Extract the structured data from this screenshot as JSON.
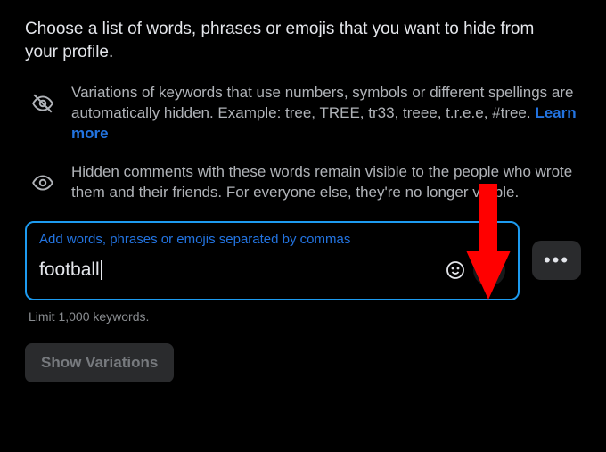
{
  "heading": "Choose a list of words, phrases or emojis that you want to hide from your profile.",
  "info1": {
    "text_before": "Variations of keywords that use numbers, symbols or different spellings are automatically hidden. Example: tree, TREE, tr33, treee, t.r.e.e, #tree. ",
    "learn_more": "Learn more"
  },
  "info2": {
    "text": "Hidden comments with these words remain visible to the people who wrote them and their friends. For everyone else, they're no longer visible."
  },
  "input": {
    "label": "Add words, phrases or emojis separated by commas",
    "value": "football"
  },
  "limit_text": "Limit 1,000 keywords.",
  "show_variations_label": "Show Variations",
  "annotation": {
    "color": "#ff0000"
  }
}
